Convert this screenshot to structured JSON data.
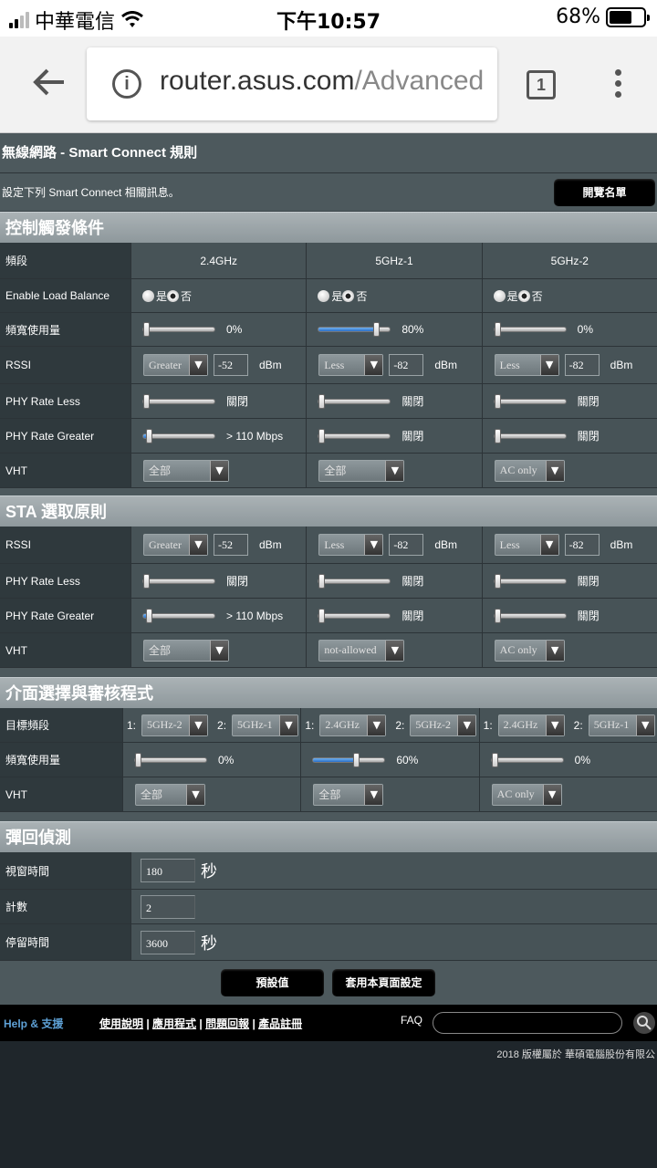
{
  "status": {
    "carrier": "中華電信",
    "time": "下午10:57",
    "battery": "68%",
    "battery_level": 0.68
  },
  "browser": {
    "url_host": "router.asus.com",
    "url_rest": "/Advanced",
    "tabs_count": "1"
  },
  "page": {
    "title": "無線網路 - Smart Connect 規則",
    "desc": "設定下列 Smart Connect 相關訊息。",
    "browse_list": "開覽名單"
  },
  "steering": {
    "heading": "控制觸發條件",
    "band_label": "頻段",
    "bands": [
      "2.4GHz",
      "5GHz-1",
      "5GHz-2"
    ],
    "load_balance_label": "Enable Load Balance",
    "yes": "是",
    "no": "否",
    "bandwidth_label": "頻寬使用量",
    "bandwidth": [
      {
        "value": 0,
        "text": "0%"
      },
      {
        "value": 80,
        "text": "80%"
      },
      {
        "value": 0,
        "text": "0%"
      }
    ],
    "rssi_label": "RSSI",
    "rssi": [
      {
        "cond": "Greater",
        "value": "-52"
      },
      {
        "cond": "Less",
        "value": "-82"
      },
      {
        "cond": "Less",
        "value": "-82"
      }
    ],
    "dbm": "dBm",
    "phy_less_label": "PHY Rate Less",
    "phy_less": [
      {
        "value": 0,
        "text": "關閉"
      },
      {
        "value": 0,
        "text": "關閉"
      },
      {
        "value": 0,
        "text": "關閉"
      }
    ],
    "phy_greater_label": "PHY Rate Greater",
    "phy_greater": [
      {
        "value": 8,
        "text": "> 110 Mbps"
      },
      {
        "value": 0,
        "text": "關閉"
      },
      {
        "value": 0,
        "text": "關閉"
      }
    ],
    "vht_label": "VHT",
    "vht": [
      "全部",
      "全部",
      "AC only"
    ]
  },
  "sta": {
    "heading": "STA 選取原則",
    "rssi_label": "RSSI",
    "rssi": [
      {
        "cond": "Greater",
        "value": "-52"
      },
      {
        "cond": "Less",
        "value": "-82"
      },
      {
        "cond": "Less",
        "value": "-82"
      }
    ],
    "dbm": "dBm",
    "phy_less_label": "PHY Rate Less",
    "phy_less": [
      {
        "value": 0,
        "text": "關閉"
      },
      {
        "value": 0,
        "text": "關閉"
      },
      {
        "value": 0,
        "text": "關閉"
      }
    ],
    "phy_greater_label": "PHY Rate Greater",
    "phy_greater": [
      {
        "value": 8,
        "text": "> 110 Mbps"
      },
      {
        "value": 0,
        "text": "關閉"
      },
      {
        "value": 0,
        "text": "關閉"
      }
    ],
    "vht_label": "VHT",
    "vht": [
      "全部",
      "not-allowed",
      "AC only"
    ]
  },
  "iface": {
    "heading": "介面選擇與審核程式",
    "target_label": "目標頻段",
    "targets": [
      {
        "t1": "5GHz-2",
        "t2": "5GHz-1"
      },
      {
        "t1": "2.4GHz",
        "t2": "5GHz-2"
      },
      {
        "t1": "2.4GHz",
        "t2": "5GHz-1"
      }
    ],
    "p1": "1:",
    "p2": "2:",
    "bandwidth_label": "頻寬使用量",
    "bandwidth": [
      {
        "value": 0,
        "text": "0%"
      },
      {
        "value": 60,
        "text": "60%"
      },
      {
        "value": 0,
        "text": "0%"
      }
    ],
    "vht_label": "VHT",
    "vht": [
      "全部",
      "全部",
      "AC only"
    ]
  },
  "bounce": {
    "heading": "彈回偵測",
    "window_label": "視窗時間",
    "window_value": "180",
    "sec": "秒",
    "count_label": "計數",
    "count_value": "2",
    "dwell_label": "停留時間",
    "dwell_value": "3600"
  },
  "buttons": {
    "default": "預設值",
    "apply": "套用本頁面設定"
  },
  "footer": {
    "help": "Help & 支援",
    "links": [
      "使用說明",
      "應用程式",
      "問題回報",
      "產品註冊"
    ],
    "faq": "FAQ",
    "copyright": "2018 版權屬於 華碩電腦股份有限公"
  }
}
